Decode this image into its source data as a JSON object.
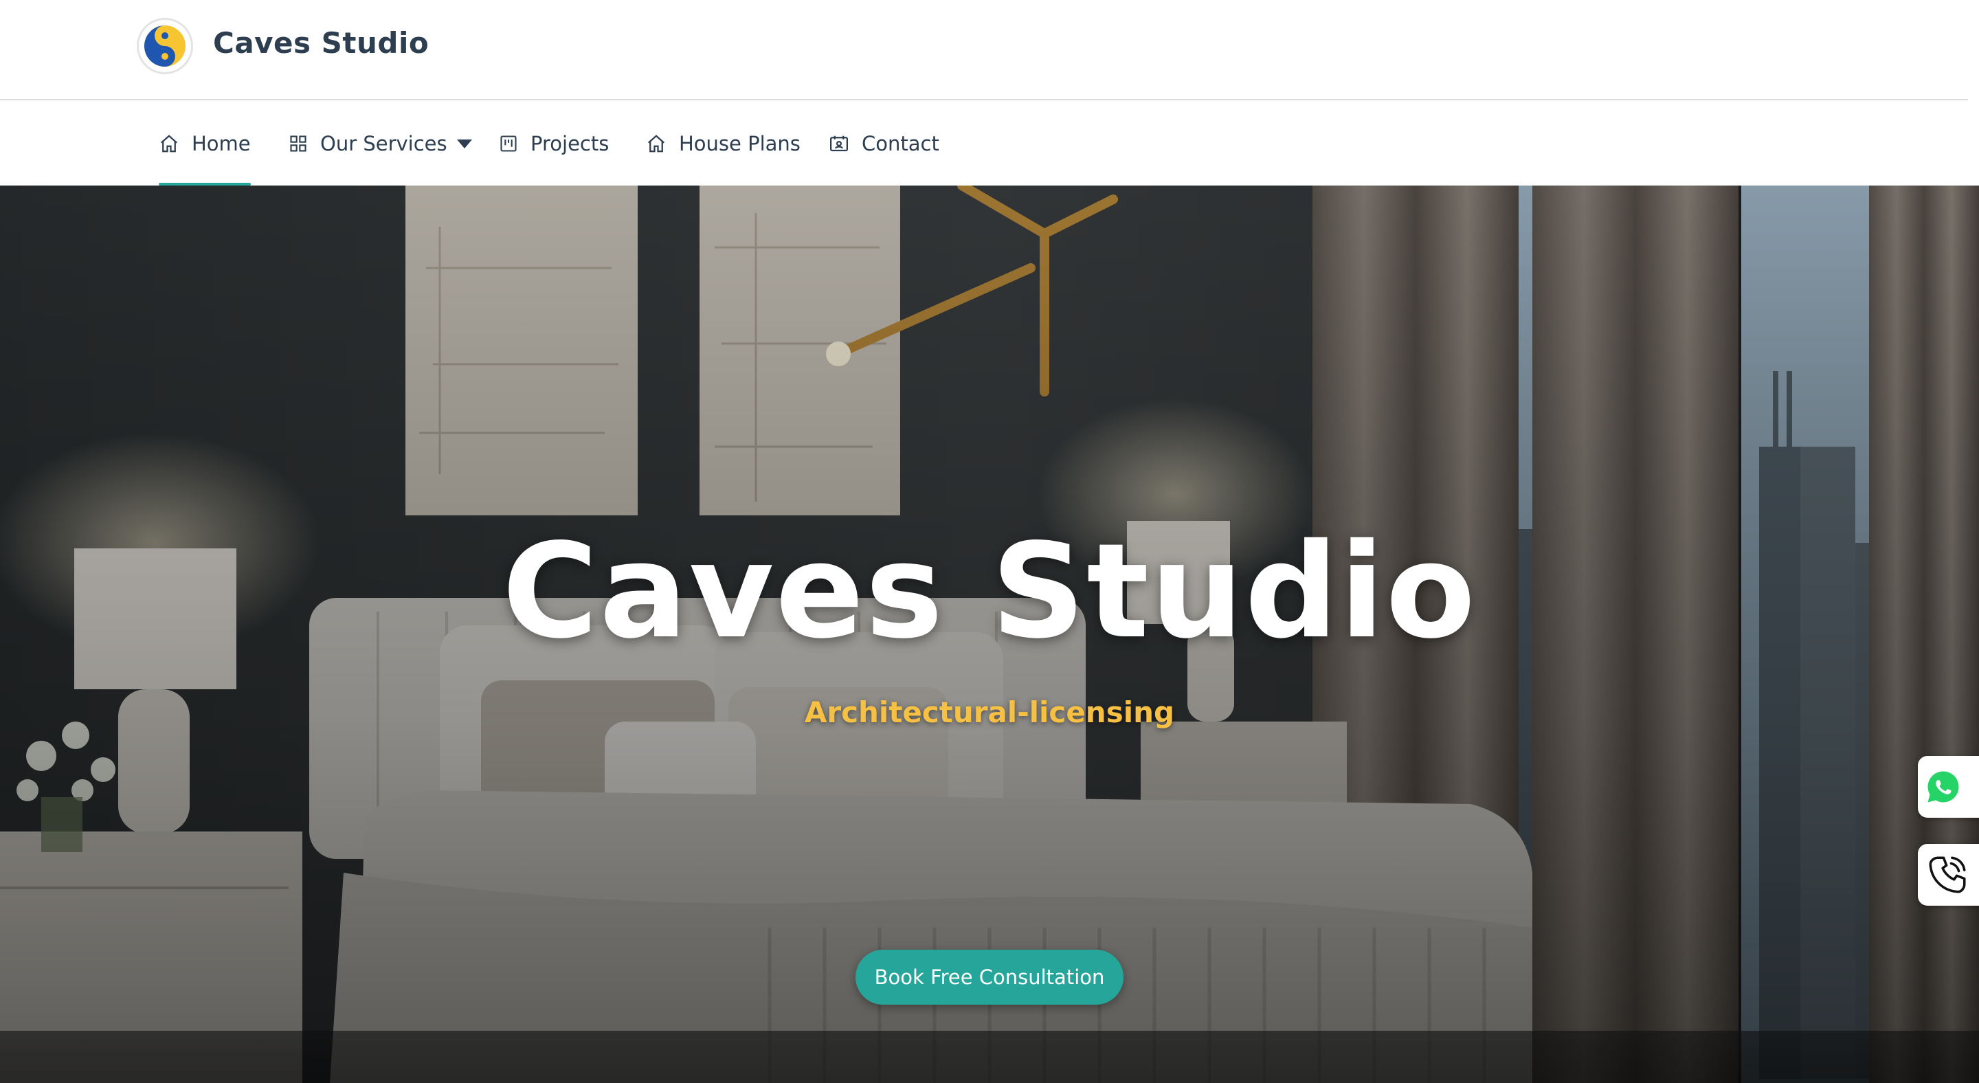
{
  "header": {
    "brand_name": "Caves Studio",
    "logo_icon": "yin-yang-logo"
  },
  "nav": {
    "items": [
      {
        "label": "Home",
        "icon": "home-icon",
        "active": true
      },
      {
        "label": "Our Services",
        "icon": "grid-icon",
        "has_dropdown": true
      },
      {
        "label": "Projects",
        "icon": "projects-icon"
      },
      {
        "label": "House Plans",
        "icon": "home-icon"
      },
      {
        "label": "Contact",
        "icon": "contact-card-icon"
      }
    ]
  },
  "hero": {
    "title": "Caves Studio",
    "subtitle": "Architectural-licensing",
    "cta_label": "Book Free Consultation"
  },
  "floating": {
    "whatsapp_icon": "whatsapp-icon",
    "phone_icon": "phone-icon"
  },
  "colors": {
    "accent": "#26a69a",
    "subtitle": "#f5c043",
    "text": "#2c3e50"
  }
}
